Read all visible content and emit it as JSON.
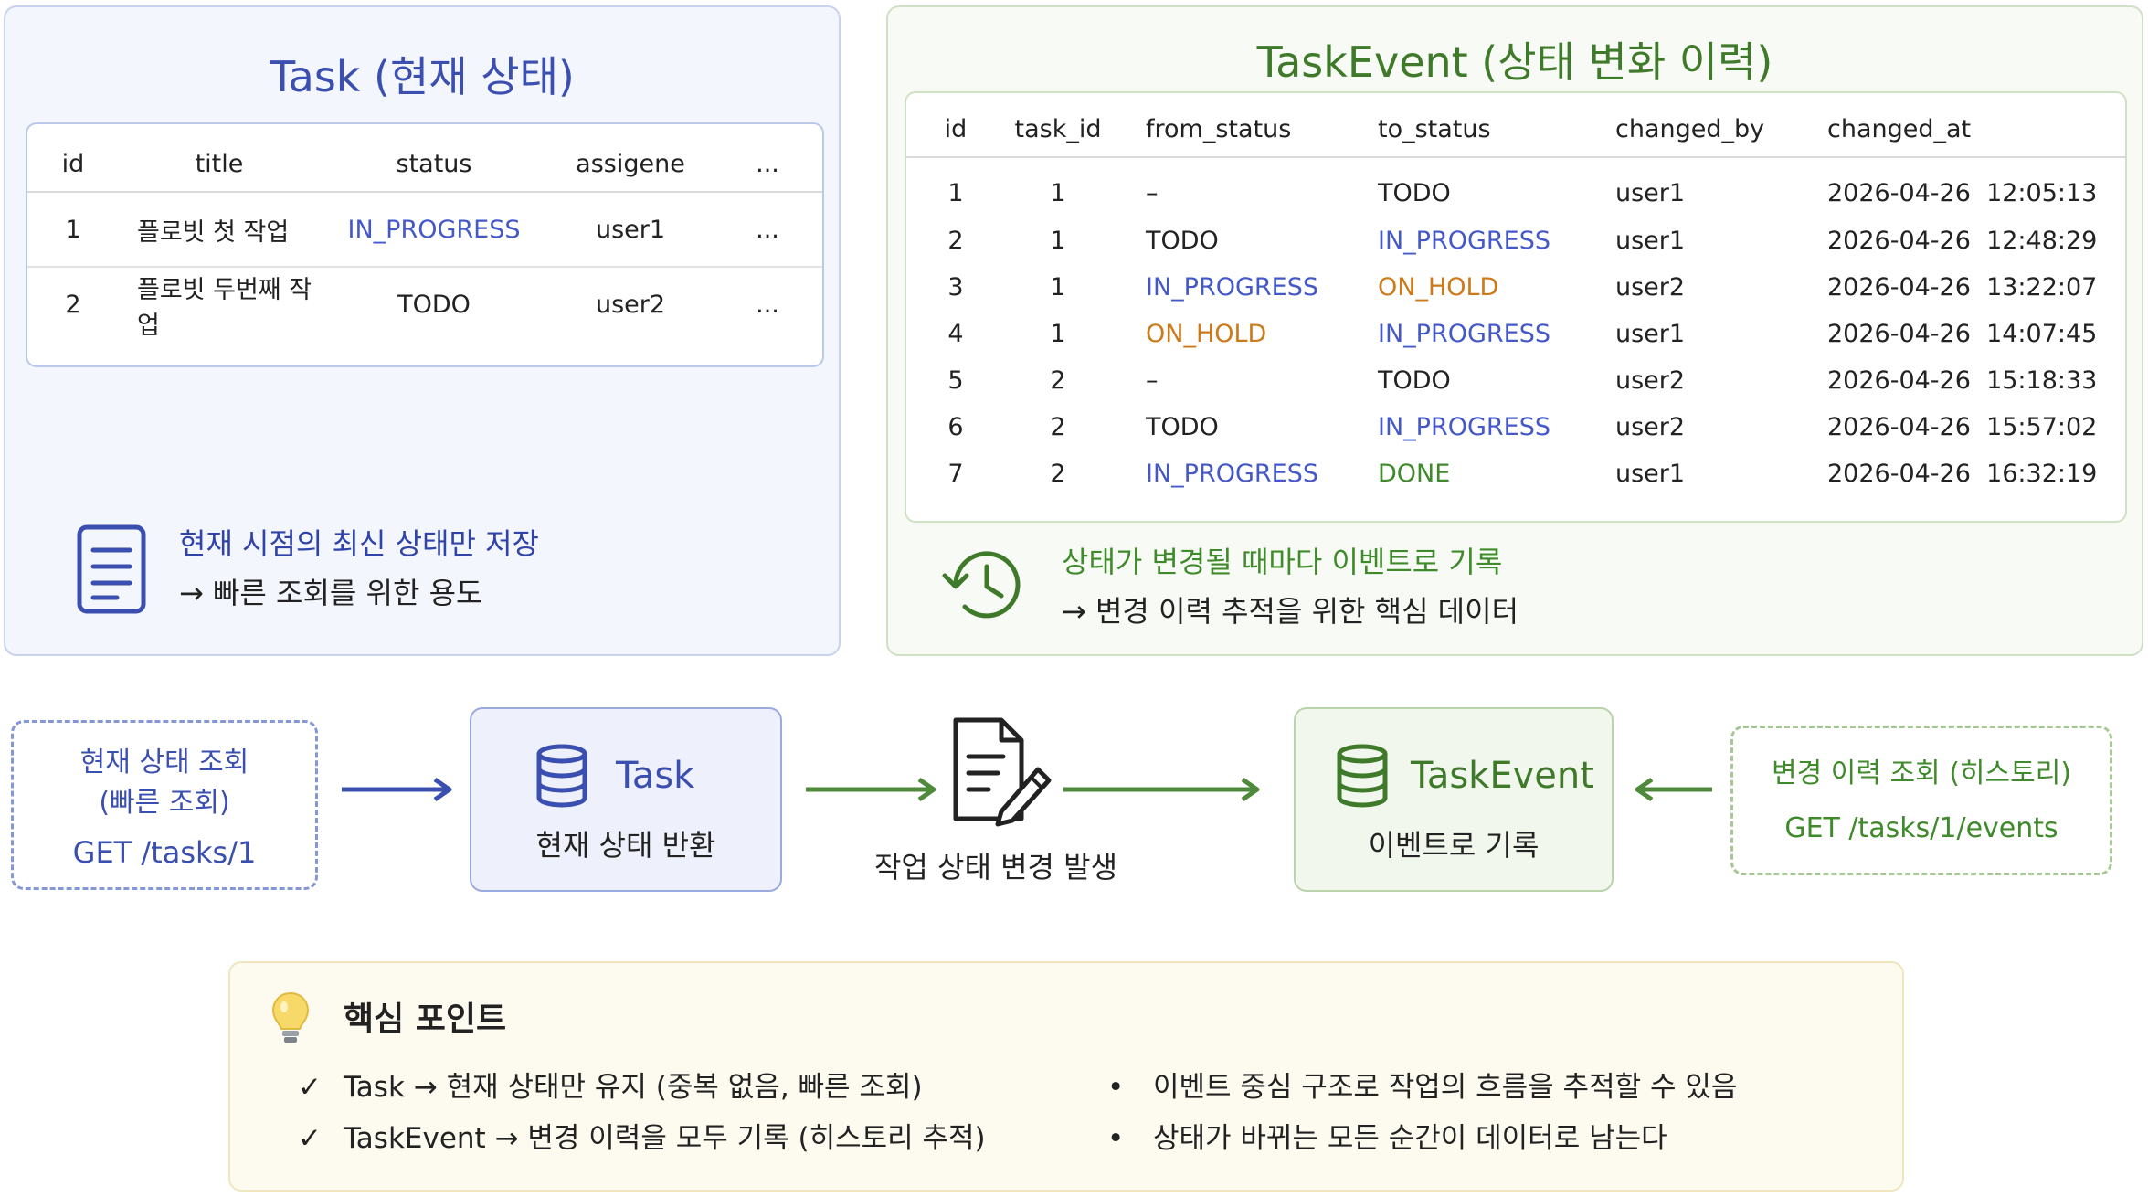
{
  "task_panel": {
    "title": "Task (현재 상태)",
    "columns": [
      "id",
      "title",
      "status",
      "assigene",
      "..."
    ],
    "rows": [
      {
        "id": "1",
        "title": "플로빗 첫 작업",
        "status": "IN_PROGRESS",
        "assignee": "user1",
        "more": "..."
      },
      {
        "id": "2",
        "title": "플로빗 두번째 작업",
        "status": "TODO",
        "assignee": "user2",
        "more": "..."
      }
    ],
    "note_line1": "현재 시점의 최신 상태만 저장",
    "note_line2": "→ 빠른 조회를 위한 용도"
  },
  "event_panel": {
    "title": "TaskEvent (상태 변화 이력)",
    "columns": [
      "id",
      "task_id",
      "from_status",
      "to_status",
      "changed_by",
      "changed_at"
    ],
    "rows": [
      {
        "id": "1",
        "task_id": "1",
        "from_status": "–",
        "to_status": "TODO",
        "changed_by": "user1",
        "changed_at": "2026-04-26  12:05:13"
      },
      {
        "id": "2",
        "task_id": "1",
        "from_status": "TODO",
        "to_status": "IN_PROGRESS",
        "changed_by": "user1",
        "changed_at": "2026-04-26  12:48:29"
      },
      {
        "id": "3",
        "task_id": "1",
        "from_status": "IN_PROGRESS",
        "to_status": "ON_HOLD",
        "changed_by": "user2",
        "changed_at": "2026-04-26  13:22:07"
      },
      {
        "id": "4",
        "task_id": "1",
        "from_status": "ON_HOLD",
        "to_status": "IN_PROGRESS",
        "changed_by": "user1",
        "changed_at": "2026-04-26  14:07:45"
      },
      {
        "id": "5",
        "task_id": "2",
        "from_status": "–",
        "to_status": "TODO",
        "changed_by": "user2",
        "changed_at": "2026-04-26  15:18:33"
      },
      {
        "id": "6",
        "task_id": "2",
        "from_status": "TODO",
        "to_status": "IN_PROGRESS",
        "changed_by": "user2",
        "changed_at": "2026-04-26  15:57:02"
      },
      {
        "id": "7",
        "task_id": "2",
        "from_status": "IN_PROGRESS",
        "to_status": "DONE",
        "changed_by": "user1",
        "changed_at": "2026-04-26  16:32:19"
      }
    ],
    "note_line1": "상태가 변경될 때마다 이벤트로 기록",
    "note_line2": "→ 변경 이력 추적을 위한 핵심 데이터"
  },
  "status_colors": {
    "IN_PROGRESS": "#4458c8",
    "ON_HOLD": "#cc7a1a",
    "DONE": "#3f8a2b",
    "TODO": "#222222"
  },
  "flow": {
    "query_current": {
      "line1": "현재 상태 조회",
      "line2": "(빠른 조회)",
      "api": "GET  /tasks/1"
    },
    "task_box": {
      "name": "Task",
      "desc": "현재 상태 반환",
      "icon": "database-icon"
    },
    "change": {
      "label": "작업 상태 변경 발생",
      "icon": "document-edit-icon"
    },
    "event_box": {
      "name": "TaskEvent",
      "desc": "이벤트로 기록",
      "icon": "database-icon"
    },
    "query_history": {
      "line1": "변경 이력 조회 (히스토리)",
      "api": "GET  /tasks/1/events"
    }
  },
  "key_points": {
    "title": "핵심 포인트",
    "icon": "lightbulb-icon",
    "left": [
      "Task → 현재 상태만 유지 (중복 없음, 빠른 조회)",
      "TaskEvent → 변경 이력을 모두 기록 (히스토리 추적)"
    ],
    "right": [
      "이벤트 중심 구조로 작업의 흐름을 추적할 수 있음",
      "상태가 바뀌는 모든 순간이 데이터로 남는다"
    ],
    "check_mark": "✓",
    "bullet_mark": "•"
  },
  "colors": {
    "task_accent": "#3b4fb0",
    "event_accent": "#3f7a2b"
  }
}
